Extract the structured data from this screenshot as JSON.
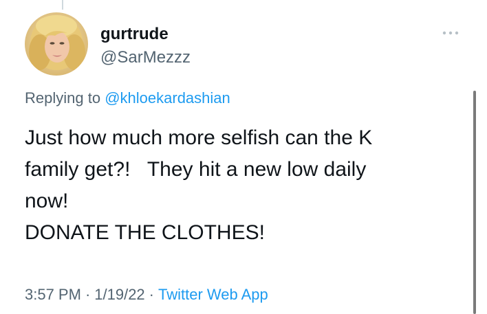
{
  "author": {
    "display_name": "gurtrude",
    "handle": "@SarMezzz",
    "avatar_icon": "profile-photo"
  },
  "more_icon": "ellipsis-icon",
  "reply": {
    "prefix": "Replying to",
    "mention": "@khloekardashian"
  },
  "tweet_text": "Just how much more selfish can the K\nfamily get?!   They hit a new low daily\nnow!\nDONATE THE CLOTHES!",
  "meta": {
    "time": "3:57 PM",
    "separator": "·",
    "date": "1/19/22",
    "source": "Twitter Web App"
  },
  "colors": {
    "link": "#1d9bf0",
    "secondary_text": "#536471",
    "primary_text": "#0f1419"
  }
}
